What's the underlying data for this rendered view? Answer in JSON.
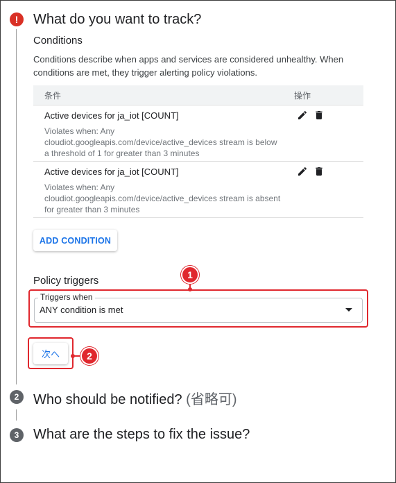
{
  "step1": {
    "marker": "!",
    "title": "What do you want to track?",
    "conditions_heading": "Conditions",
    "conditions_description": "Conditions describe when apps and services are considered unhealthy. When conditions are met, they trigger alerting policy violations.",
    "table": {
      "headers": [
        "条件",
        "操作"
      ],
      "rows": [
        {
          "name": "Active devices for ja_iot [COUNT]",
          "violation": "Violates when: Any cloudiot.googleapis.com/device/active_devices stream is below a threshold of 1 for greater than 3 minutes"
        },
        {
          "name": "Active devices for ja_iot [COUNT]",
          "violation": "Violates when: Any cloudiot.googleapis.com/device/active_devices stream is absent for greater than 3 minutes"
        }
      ]
    },
    "add_condition_label": "ADD CONDITION",
    "policy_triggers_heading": "Policy triggers",
    "triggers_when_label": "Triggers when",
    "triggers_when_value": "ANY condition is met",
    "next_label": "次へ"
  },
  "step2": {
    "marker": "2",
    "title": "Who should be notified?",
    "optional": "(省略可)"
  },
  "step3": {
    "marker": "3",
    "title": "What are the steps to fix the issue?"
  },
  "callouts": [
    "1",
    "2"
  ],
  "colors": {
    "accent": "#1a73e8",
    "error": "#d93025",
    "annotation": "#e0282e"
  }
}
